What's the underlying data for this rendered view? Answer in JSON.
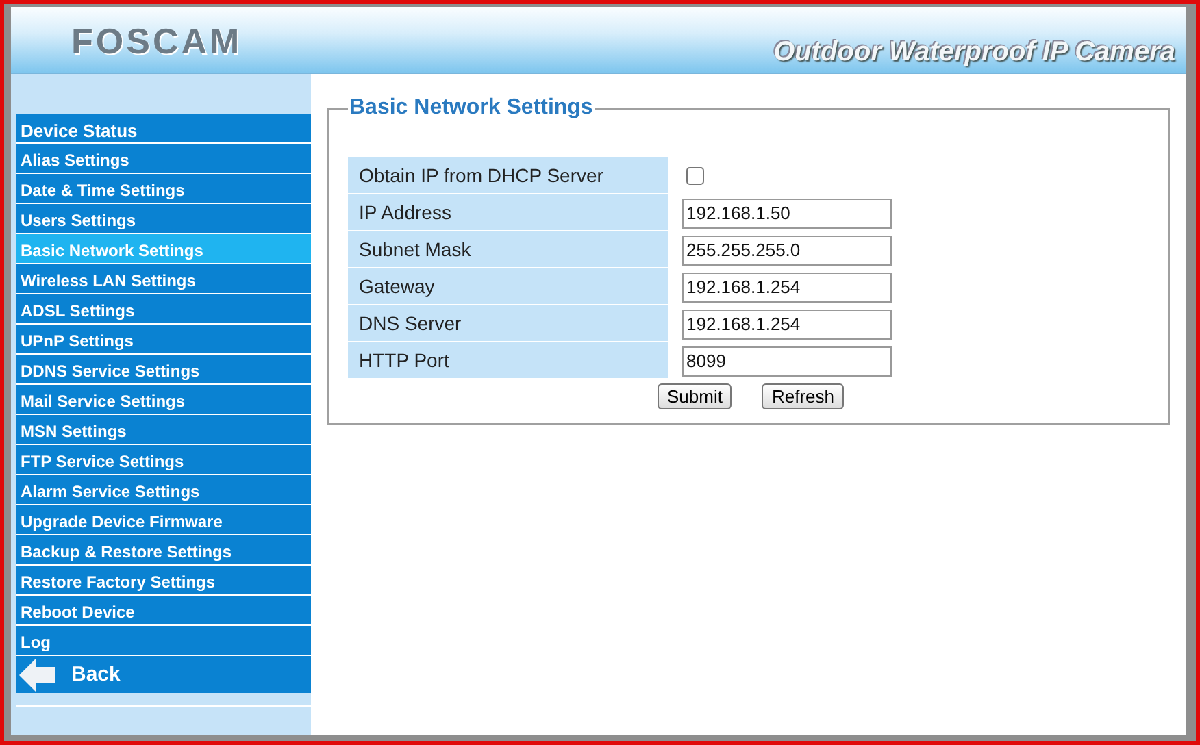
{
  "header": {
    "logo": "FOSCAM",
    "tagline": "Outdoor Waterproof IP Camera"
  },
  "sidebar": {
    "items": [
      {
        "label": "Device Status",
        "selected": false
      },
      {
        "label": "Alias Settings",
        "selected": false
      },
      {
        "label": "Date & Time Settings",
        "selected": false
      },
      {
        "label": "Users Settings",
        "selected": false
      },
      {
        "label": "Basic Network Settings",
        "selected": true
      },
      {
        "label": "Wireless LAN Settings",
        "selected": false
      },
      {
        "label": "ADSL Settings",
        "selected": false
      },
      {
        "label": "UPnP Settings",
        "selected": false
      },
      {
        "label": "DDNS Service Settings",
        "selected": false
      },
      {
        "label": "Mail Service Settings",
        "selected": false
      },
      {
        "label": "MSN Settings",
        "selected": false
      },
      {
        "label": "FTP Service Settings",
        "selected": false
      },
      {
        "label": "Alarm Service Settings",
        "selected": false
      },
      {
        "label": "Upgrade Device Firmware",
        "selected": false
      },
      {
        "label": "Backup & Restore Settings",
        "selected": false
      },
      {
        "label": "Restore Factory Settings",
        "selected": false
      },
      {
        "label": "Reboot Device",
        "selected": false
      },
      {
        "label": "Log",
        "selected": false
      }
    ],
    "back": "Back"
  },
  "form": {
    "title": "Basic Network Settings",
    "fields": [
      {
        "kind": "checkbox",
        "label": "Obtain IP from DHCP Server",
        "checked": false
      },
      {
        "kind": "text",
        "label": "IP Address",
        "value": "192.168.1.50"
      },
      {
        "kind": "text",
        "label": "Subnet Mask",
        "value": "255.255.255.0"
      },
      {
        "kind": "text",
        "label": "Gateway",
        "value": "192.168.1.254"
      },
      {
        "kind": "text",
        "label": "DNS Server",
        "value": "192.168.1.254"
      },
      {
        "kind": "text",
        "label": "HTTP Port",
        "value": "8099"
      }
    ],
    "buttons": [
      "Submit",
      "Refresh"
    ]
  }
}
